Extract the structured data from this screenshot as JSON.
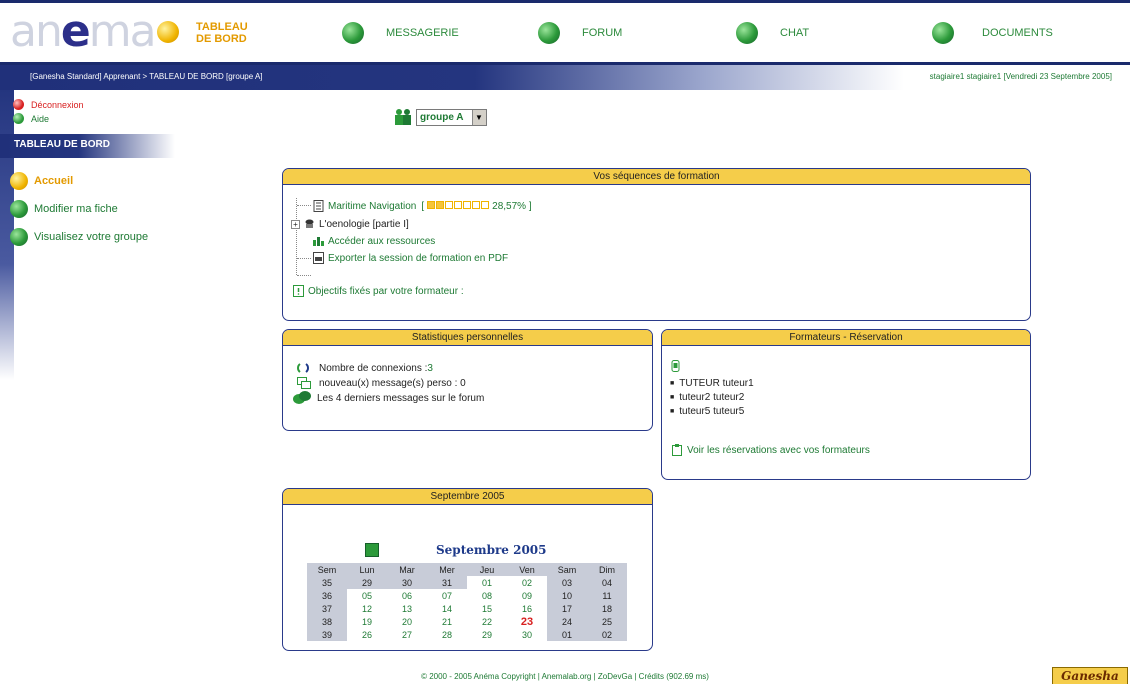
{
  "logo": {
    "text_a": "an",
    "text_e": "e",
    "text_b": "ma"
  },
  "nav": [
    {
      "label": "TABLEAU DE BORD",
      "active": true
    },
    {
      "label": "MESSAGERIE",
      "active": false
    },
    {
      "label": "FORUM",
      "active": false
    },
    {
      "label": "CHAT",
      "active": false
    },
    {
      "label": "DOCUMENTS",
      "active": false
    }
  ],
  "breadcrumb": "[Ganesha Standard] Apprenant > TABLEAU DE BORD [groupe A]",
  "userinfo": "stagiaire1 stagiaire1 [Vendredi 23 Septembre 2005]",
  "sidebar": {
    "logout": "Déconnexion",
    "help": "Aide",
    "header": "TABLEAU DE BORD",
    "menu": [
      {
        "label": "Accueil",
        "active": true
      },
      {
        "label": "Modifier ma fiche",
        "active": false
      },
      {
        "label": "Visualisez votre groupe",
        "active": false
      }
    ]
  },
  "group_select": {
    "value": "groupe A"
  },
  "sequences": {
    "title": "Vos séquences de formation",
    "course1": "Maritime Navigation",
    "progress_open": "[",
    "progress_percent": "28,57% ]",
    "progress_fraction": 0.2857,
    "course2": "L'oenologie [partie I]",
    "resources": "Accéder aux ressources",
    "export_pdf": "Exporter la session de formation en PDF",
    "objectives": "Objectifs fixés par votre formateur :"
  },
  "stats": {
    "title": "Statistiques personnelles",
    "connections_label": "Nombre de connexions : ",
    "connections_value": "3",
    "messages": "nouveau(x) message(s) perso : 0",
    "forum": "Les 4 derniers messages sur le forum"
  },
  "tutors": {
    "title": "Formateurs - Réservation",
    "list": [
      "TUTEUR tuteur1",
      "tuteur2 tuteur2",
      "tuteur5 tuteur5"
    ],
    "reservations_link": "Voir les réservations avec vos formateurs"
  },
  "calendar": {
    "panel_title": "Septembre  2005",
    "title": "Septembre  2005",
    "headers": [
      "Sem",
      "Lun",
      "Mar",
      "Mer",
      "Jeu",
      "Ven",
      "Sam",
      "Dim"
    ],
    "rows": [
      [
        "35",
        "29",
        "30",
        "31",
        "01",
        "02",
        "03",
        "04"
      ],
      [
        "36",
        "05",
        "06",
        "07",
        "08",
        "09",
        "10",
        "11"
      ],
      [
        "37",
        "12",
        "13",
        "14",
        "15",
        "16",
        "17",
        "18"
      ],
      [
        "38",
        "19",
        "20",
        "21",
        "22",
        "23",
        "24",
        "25"
      ],
      [
        "39",
        "26",
        "27",
        "28",
        "29",
        "30",
        "01",
        "02"
      ]
    ],
    "today": "23"
  },
  "footer": "© 2000 - 2005 Anéma Copyright | Anemalab.org | ZoDevGa | Crédits (902.69 ms)",
  "ganesha_badge": "Ganesha"
}
